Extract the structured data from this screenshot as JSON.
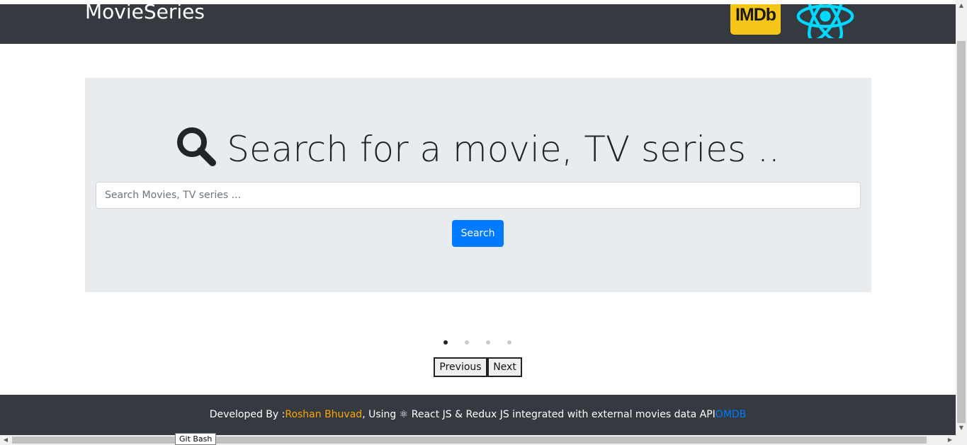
{
  "navbar": {
    "brand": "MovieSeries",
    "imdb_logo_text": "IMDb",
    "react_logo_icon": "react-atom-icon"
  },
  "jumbotron": {
    "heading_icon": "search-icon",
    "heading": "Search for a movie, TV series ..",
    "search_placeholder": "Search Movies, TV series ...",
    "search_value": "",
    "search_button": "Search"
  },
  "carousel": {
    "dots": [
      {
        "state": "active"
      },
      {
        "state": "inactive"
      },
      {
        "state": "inactive"
      },
      {
        "state": "inactive"
      }
    ],
    "previous_label": "Previous",
    "next_label": "Next"
  },
  "footer": {
    "prefix": "Developed By :",
    "author": "Roshan Bhuvad",
    "using": ", Using ",
    "react_glyph": "⚛",
    "middle": " React JS & Redux JS integrated with external movies data API",
    "api_link": "OMDB"
  },
  "taskbar_tooltip": "Git Bash",
  "colors": {
    "navbar_bg": "#343a40",
    "jumbotron_bg": "#e9ecef",
    "primary": "#007bff",
    "author_accent": "#ffa500",
    "imdb_yellow": "#f5c518",
    "react_cyan": "#00d8ff"
  }
}
